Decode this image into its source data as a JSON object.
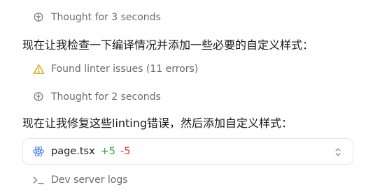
{
  "steps": {
    "thought_1": {
      "icon": "brain-icon",
      "text": "Thought for 3 seconds"
    },
    "message_1": "现在让我检查一下编译情况并添加一些必要的自定义样式：",
    "linter": {
      "icon": "warning-triangle-icon",
      "text": "Found linter issues (11 errors)"
    },
    "thought_2": {
      "icon": "brain-icon",
      "text": "Thought for 2 seconds"
    },
    "message_2": "现在让我修复这些linting错误，然后添加自定义样式：",
    "file_change": {
      "icon": "react-icon",
      "file_name": "page.tsx",
      "added": "+5",
      "removed": "-5"
    },
    "server_logs": {
      "icon": "terminal-prompt-icon",
      "text": "Dev server logs"
    }
  },
  "colors": {
    "muted_text": "#6b6b6b",
    "warning": "#d9a21b",
    "react": "#5b8def",
    "added": "#2e9e4a",
    "removed": "#d63a2f"
  }
}
